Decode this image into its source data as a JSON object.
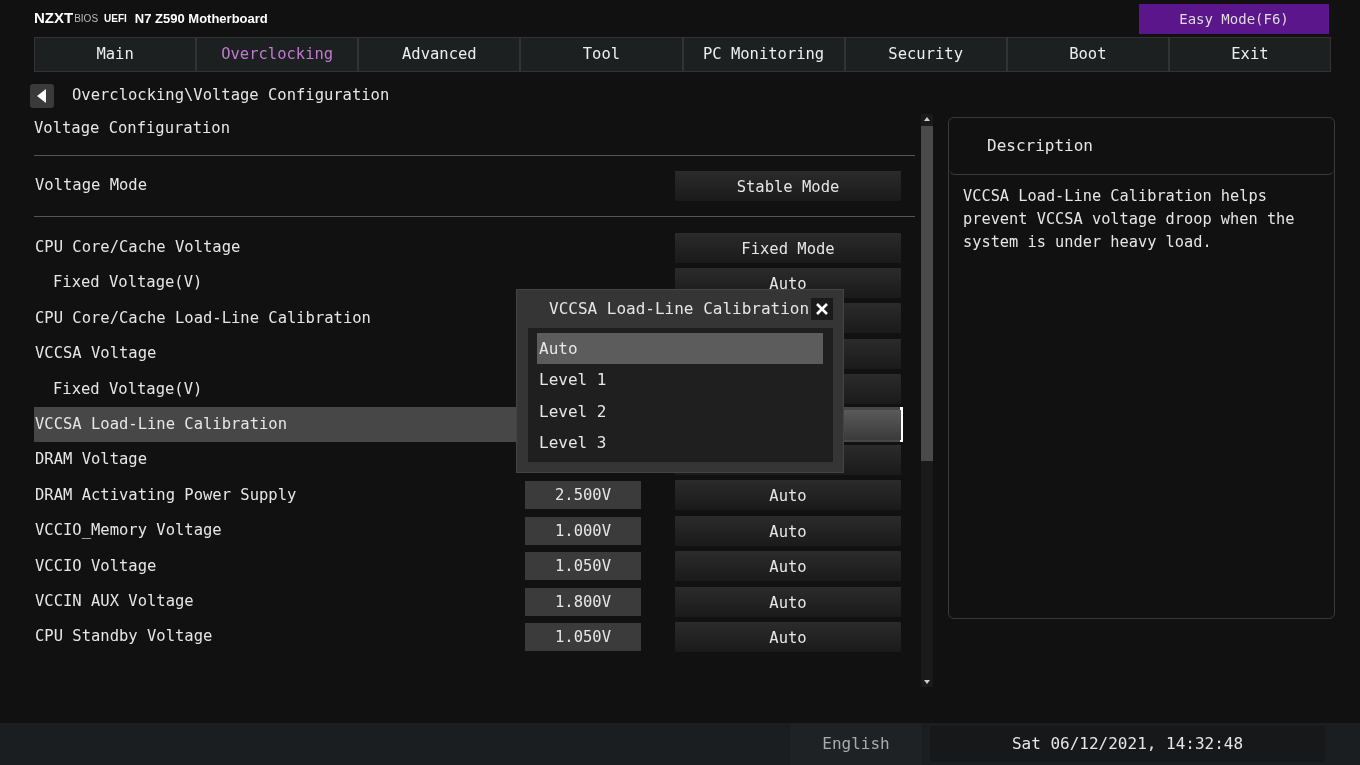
{
  "header": {
    "brand": "NZXT",
    "bios": "BIOS",
    "uefi": "UEFI",
    "board": "N7 Z590 Motherboard"
  },
  "easy_mode_button": "Easy Mode(F6)",
  "tabs": [
    {
      "label": "Main",
      "selected": false
    },
    {
      "label": "Overclocking",
      "selected": true
    },
    {
      "label": "Advanced",
      "selected": false
    },
    {
      "label": "Tool",
      "selected": false
    },
    {
      "label": "PC Monitoring",
      "selected": false
    },
    {
      "label": "Security",
      "selected": false
    },
    {
      "label": "Boot",
      "selected": false
    },
    {
      "label": "Exit",
      "selected": false
    }
  ],
  "breadcrumb": "Overclocking\\Voltage Configuration",
  "section_title": "Voltage Configuration",
  "mode_setting": {
    "label": "Voltage Mode",
    "option": "Stable Mode"
  },
  "settings": [
    {
      "label": "CPU Core/Cache Voltage",
      "option": "Fixed Mode",
      "selected": false,
      "children": [
        {
          "label": "Fixed Voltage(V)",
          "option": "Auto",
          "selected": false
        }
      ]
    },
    {
      "label": "CPU Core/Cache Load-Line Calibration",
      "selected": false
    },
    {
      "label": "VCCSA Voltage",
      "selected": false,
      "children": [
        {
          "label": "Fixed Voltage(V)",
          "selected": false
        }
      ]
    },
    {
      "label": "VCCSA Load-Line Calibration",
      "selected": true
    },
    {
      "label": "DRAM Voltage",
      "selected": false
    },
    {
      "label": "DRAM Activating Power Supply",
      "reading": "2.500V",
      "option": "Auto",
      "selected": false
    },
    {
      "label": "VCCIO_Memory Voltage",
      "reading": "1.000V",
      "option": "Auto",
      "selected": false
    },
    {
      "label": "VCCIO Voltage",
      "reading": "1.050V",
      "option": "Auto",
      "selected": false
    },
    {
      "label": "VCCIN AUX Voltage",
      "reading": "1.800V",
      "option": "Auto",
      "selected": false
    },
    {
      "label": "CPU Standby Voltage",
      "reading": "1.050V",
      "option": "Auto",
      "selected": false
    }
  ],
  "popup": {
    "title": "VCCSA Load-Line Calibration",
    "options": [
      {
        "label": "Auto",
        "selected": true
      },
      {
        "label": "Level 1",
        "selected": false
      },
      {
        "label": "Level 2",
        "selected": false
      },
      {
        "label": "Level 3",
        "selected": false
      }
    ]
  },
  "description": {
    "title": "Description",
    "text": "VCCSA Load-Line Calibration helps prevent VCCSA voltage droop when the system is under heavy load."
  },
  "status_bar": {
    "language": "English",
    "datetime": "Sat 06/12/2021, 14:32:48"
  }
}
